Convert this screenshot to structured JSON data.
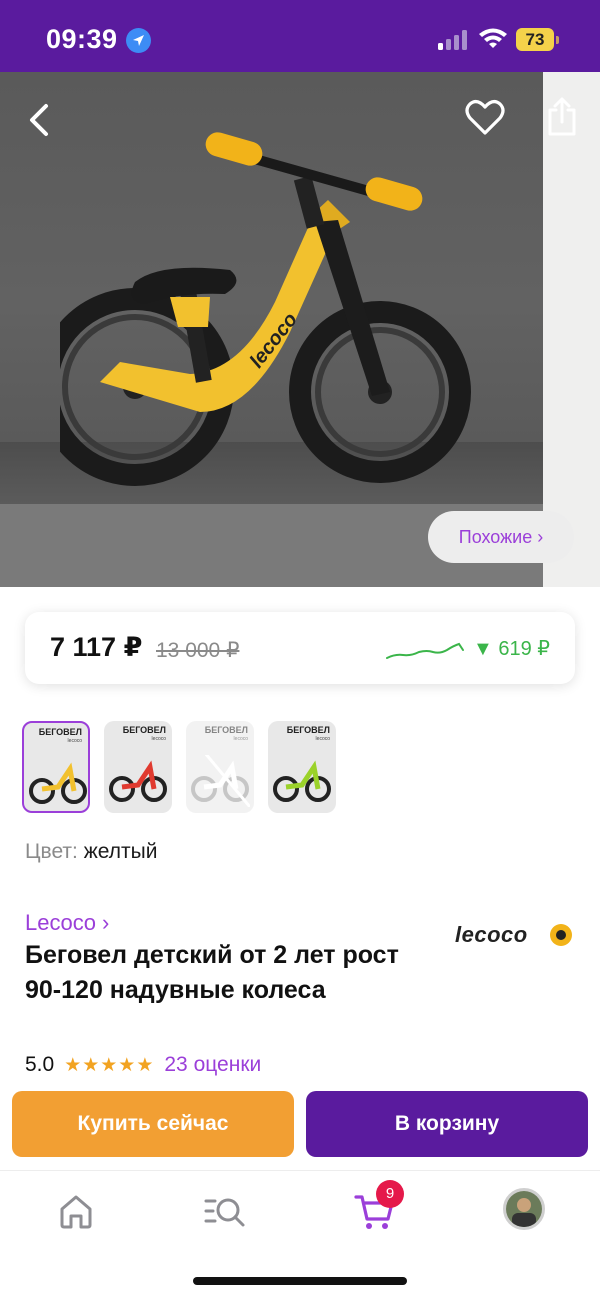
{
  "status_bar": {
    "time": "09:39",
    "battery": "73"
  },
  "hero": {
    "similar_label": "Похожие ›",
    "bike_brand_mark": "lecoco"
  },
  "price": {
    "current": "7 117 ₽",
    "old": "13 000 ₽",
    "drop": "▼ 619 ₽"
  },
  "variants": [
    {
      "label": "БЕГОВЕЛ",
      "sub": "lecoco",
      "color": "#f2c12e",
      "selected": true
    },
    {
      "label": "БЕГОВЕЛ",
      "sub": "lecoco",
      "color": "#e03a2f",
      "selected": false
    },
    {
      "label": "БЕГОВЕЛ",
      "sub": "lecoco",
      "color": "#ffffff",
      "selected": false,
      "unavailable": true
    },
    {
      "label": "БЕГОВЕЛ",
      "sub": "lecoco",
      "color": "#9bd22a",
      "selected": false
    }
  ],
  "color_field": {
    "label": "Цвет:",
    "value": "желтый"
  },
  "product": {
    "brand_link": "Lecoco ›",
    "brand_logo": "lecoco",
    "title": "Беговел детский от 2 лет рост 90-120 надувные колеса",
    "rating": "5.0",
    "stars": "★★★★★",
    "rating_count": "23 оценки"
  },
  "actions": {
    "buy_now": "Купить сейчас",
    "add_to_cart": "В корзину"
  },
  "tab_bar": {
    "cart_badge": "9"
  },
  "colors": {
    "brand_purple": "#5a1b9e",
    "accent_purple": "#9b3fd9",
    "orange": "#f29f33",
    "green": "#3bb54a",
    "badge_red": "#e5194a"
  }
}
